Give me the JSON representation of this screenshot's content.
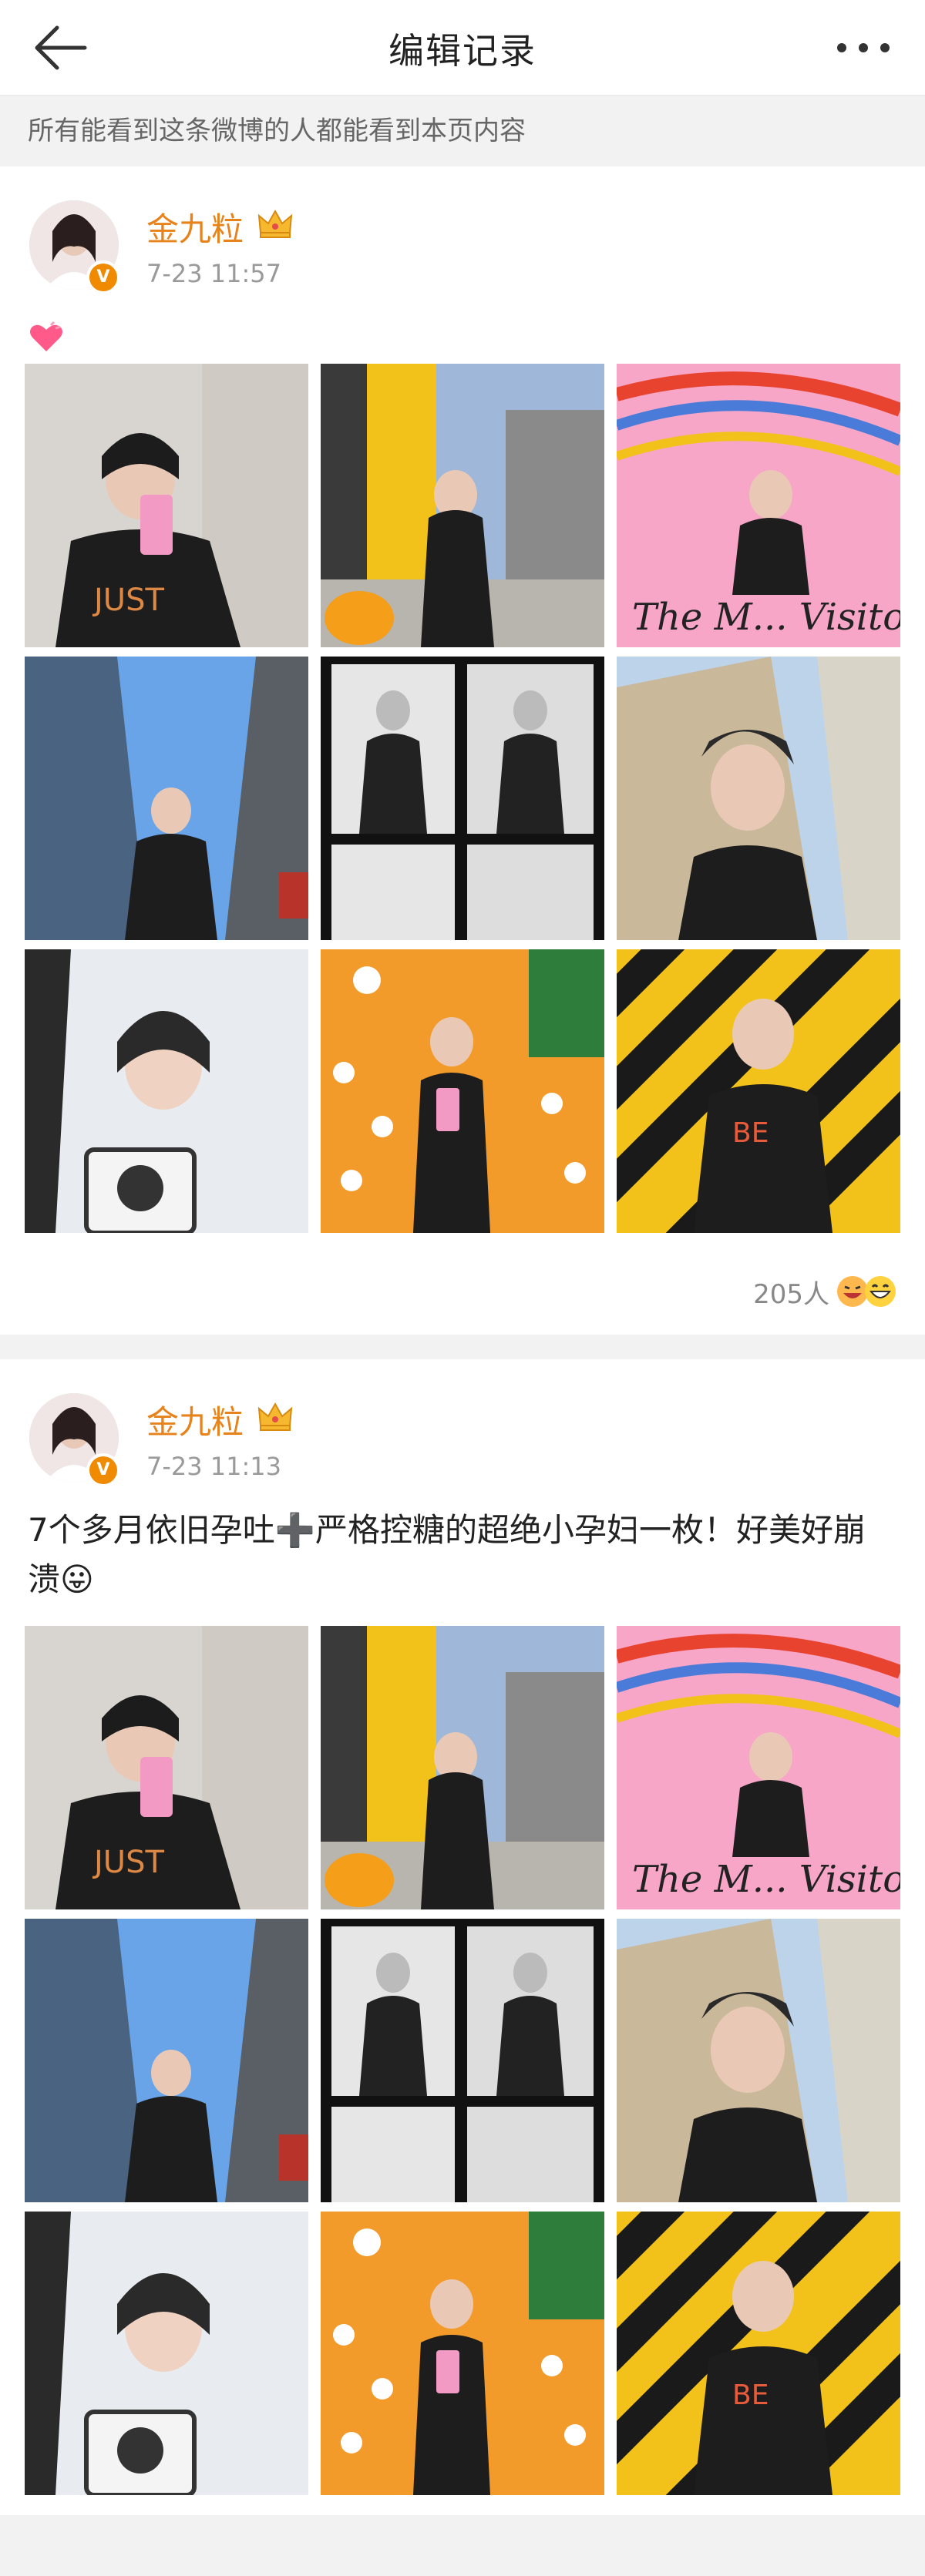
{
  "header": {
    "title": "编辑记录",
    "back_icon": "back-arrow-icon",
    "more_icon": "more-dots-icon"
  },
  "notice": "所有能看到这条微博的人都能看到本页内容",
  "posts": [
    {
      "username": "金九粒",
      "timestamp": "7-23 11:57",
      "text": "",
      "text_emoji": "heart-emoji",
      "photos": [
        {
          "desc": "mirror selfie with phone"
        },
        {
          "desc": "street with yellow wall"
        },
        {
          "desc": "pink graffiti wall"
        },
        {
          "desc": "low angle with buildings and sky"
        },
        {
          "desc": "photo booth strip"
        },
        {
          "desc": "selfie with graffiti building"
        },
        {
          "desc": "in car with camera"
        },
        {
          "desc": "orange flower tiled wall mirror selfie"
        },
        {
          "desc": "yellow black striped wall"
        }
      ],
      "likes": "205人",
      "reaction_icons": [
        "laugh-emoji",
        "grin-emoji"
      ]
    },
    {
      "username": "金九粒",
      "timestamp": "7-23 11:13",
      "text": "7个多月依旧孕吐➕严格控糖的超绝小孕妇一枚！好美好崩溃😛",
      "photos": [
        {
          "desc": "mirror selfie with phone"
        },
        {
          "desc": "street with yellow wall"
        },
        {
          "desc": "pink graffiti wall"
        },
        {
          "desc": "low angle with buildings and sky"
        },
        {
          "desc": "photo booth strip"
        },
        {
          "desc": "selfie with graffiti building"
        },
        {
          "desc": "in car with camera"
        },
        {
          "desc": "orange flower tiled wall mirror selfie"
        },
        {
          "desc": "yellow black striped wall"
        }
      ]
    }
  ],
  "colors": {
    "username": "#e8831c",
    "verify_badge": "#f08a00",
    "timestamp": "#9a9a9a"
  }
}
